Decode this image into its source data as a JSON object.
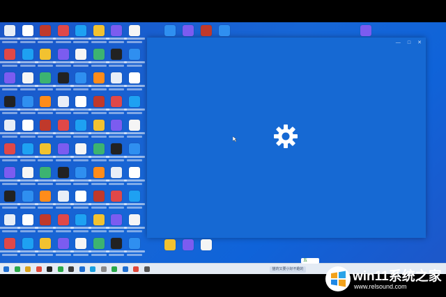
{
  "window": {
    "controls": [
      "—",
      "□",
      "✕"
    ]
  },
  "taskbar": {
    "search_placeholder": "猫药又要小好不趣的",
    "ime_label": "五"
  },
  "watermark": {
    "title": "win11系统之家",
    "url": "www.relsound.com"
  },
  "colors": {
    "desktop": "#1766d6",
    "window": "#1669d3",
    "taskbar": "#e4ebf4",
    "gear": "#ffffff"
  },
  "icons": {
    "gear": "gear-icon",
    "cursor": "cursor-icon"
  }
}
